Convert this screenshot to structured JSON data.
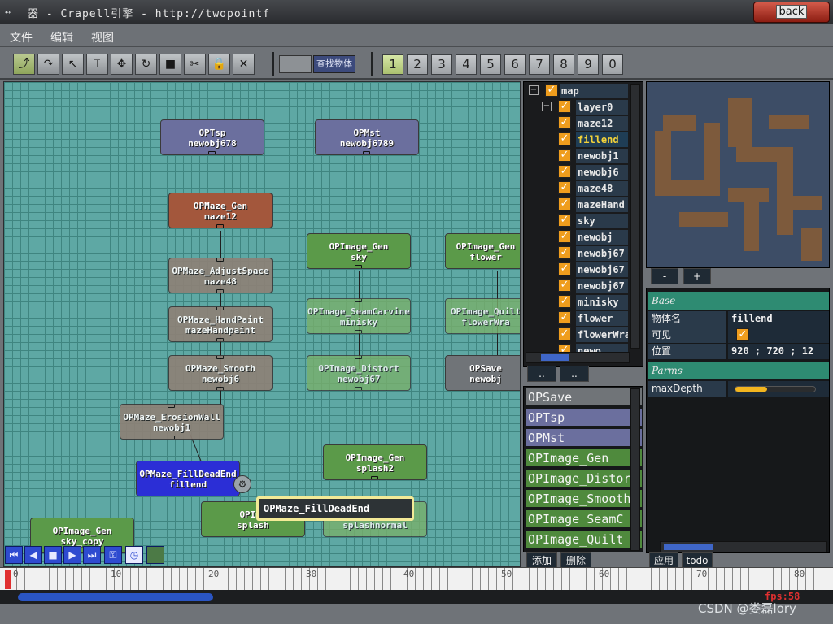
{
  "window": {
    "title": "器 - Crapell引擎 - http://twopointf",
    "back_label": "back"
  },
  "menu": [
    "文件",
    "编辑",
    "视图"
  ],
  "toolbar": {
    "tools": [
      "curve-tool",
      "rotate-curve-tool",
      "select-tool",
      "text-tool",
      "move-tool",
      "refresh-tool",
      "stop-tool",
      "cut-tool",
      "lock-tool",
      "delete-tool"
    ],
    "search_label": "查找物体",
    "layers": [
      "1",
      "2",
      "3",
      "4",
      "5",
      "6",
      "7",
      "8",
      "9",
      "0"
    ],
    "active_layer": "1"
  },
  "nodes": [
    {
      "type": "OPTsp",
      "name": "newobj678"
    },
    {
      "type": "OPMst",
      "name": "newobj6789"
    },
    {
      "type": "OPMaze_Gen",
      "name": "maze12"
    },
    {
      "type": "OPMaze_AdjustSpace",
      "name": "maze48"
    },
    {
      "type": "OPMaze_HandPaint",
      "name": "mazeHandpaint"
    },
    {
      "type": "OPMaze_Smooth",
      "name": "newobj6"
    },
    {
      "type": "OPMaze_ErosionWall",
      "name": "newobj1"
    },
    {
      "type": "OPMaze_FillDeadEnd",
      "name": "fillend"
    },
    {
      "type": "OPImage_Gen",
      "name": "sky"
    },
    {
      "type": "OPImage_SeamCarvine",
      "name": "minisky"
    },
    {
      "type": "OPImage_Distort",
      "name": "newobj67"
    },
    {
      "type": "OPImage_Gen",
      "name": "flower"
    },
    {
      "type": "OPImage_Quilt",
      "name": "flowerWra"
    },
    {
      "type": "OPSave",
      "name": "newobj"
    },
    {
      "type": "OPImage_Gen",
      "name": "splash2"
    },
    {
      "type": "OPImage_Gen",
      "name": "sky_copy"
    },
    {
      "type": "OPIma",
      "name": "splash"
    },
    {
      "type": "l",
      "name": "splashnormal"
    }
  ],
  "tooltip": "OPMaze_FillDeadEnd",
  "tree": {
    "root": "map",
    "items": [
      "layer0",
      "maze12",
      "fillend",
      "newobj1",
      "newobj6",
      "maze48",
      "mazeHand",
      "sky",
      "newobj",
      "newobj67",
      "newobj67",
      "newobj67",
      "minisky",
      "flower",
      "flowerWra",
      "newo"
    ],
    "selected": "fillend",
    "buttons": [
      "..",
      ".."
    ]
  },
  "preview": {
    "minus": "-",
    "plus": "+"
  },
  "palette": {
    "items": [
      {
        "label": "OPSave",
        "color": "#707478"
      },
      {
        "label": "OPTsp",
        "color": "#6b6f9e"
      },
      {
        "label": "OPMst",
        "color": "#6b6f9e"
      },
      {
        "label": "OPImage_Gen",
        "color": "#4f8a3d"
      },
      {
        "label": "OPImage_Distort",
        "color": "#4f8a3d"
      },
      {
        "label": "OPImage_Smooth",
        "color": "#4f8a3d"
      },
      {
        "label": "OPImage_SeamC",
        "color": "#4f8a3d"
      },
      {
        "label": "OPImage_Quilt",
        "color": "#4f8a3d"
      }
    ],
    "add": "添加",
    "delete": "删除"
  },
  "props": {
    "base_section": "Base",
    "name_label": "物体名",
    "name_value": "fillend",
    "visible_label": "可见",
    "pos_label": "位置",
    "pos_value": "920 ; 720 ; 12",
    "parms_section": "Parms",
    "maxdepth_label": "maxDepth",
    "maxdepth_value": 0.4,
    "apply": "应用",
    "todo": "todo"
  },
  "timeline": {
    "ticks": [
      "0",
      "10",
      "20",
      "30",
      "40",
      "50",
      "60",
      "70",
      "80"
    ],
    "fps": "fps:58"
  },
  "watermark": "CSDN @娄磊lory"
}
